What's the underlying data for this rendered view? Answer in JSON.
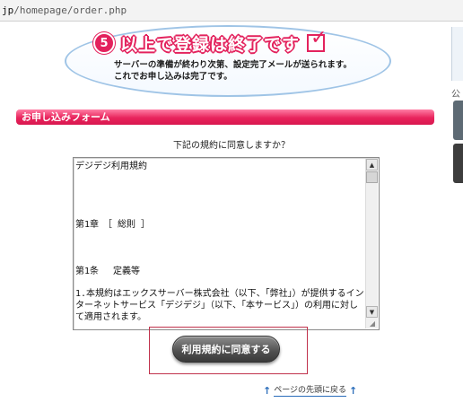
{
  "address_bar": {
    "url_prefix": "jp",
    "url_path": "/homepage/order.php"
  },
  "banner": {
    "step_number": "5",
    "title": "以上で登録は終了です",
    "description_line1": "サーバーの準備が終わり次第、設定完了メールが送られます。",
    "description_line2": "これでお申し込みは完了です。",
    "accent_color": "#e3225d"
  },
  "right_side": {
    "label": "公"
  },
  "form": {
    "section_title": "お申し込みフォーム",
    "question": "下記の規約に同意しますか？",
    "terms": {
      "title": "デジデジ利用規約",
      "chapter": "第1章　［ 総則 ］",
      "article": "第1条　 定義等",
      "body": "1.本規約はエックスサーバー株式会社（以下、「弊社」）が提供するインターネットサービス「デジデジ」（以下、「本サービス」）の利用に対して適用されます。"
    },
    "agree_button": "利用規約に同意する"
  },
  "back_to_top": "ページの先頭に戻る",
  "icons": {
    "check": "check-icon",
    "up": "arrow-up-icon"
  }
}
